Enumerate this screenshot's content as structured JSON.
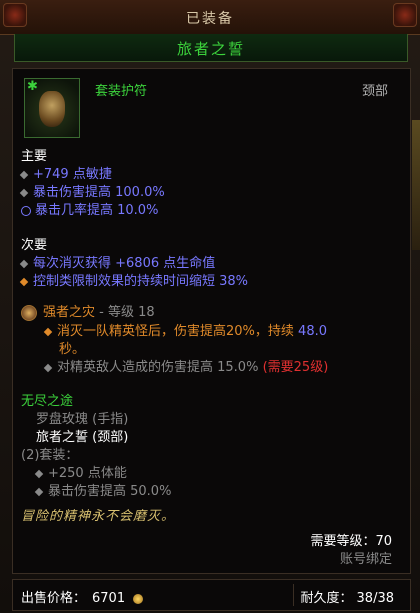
{
  "header": {
    "equipped_label": "已装备",
    "item_name": "旅者之誓"
  },
  "item": {
    "type": "套装护符",
    "slot": "颈部",
    "icon": "amulet-icon"
  },
  "primary": {
    "title": "主要",
    "stats": [
      "+749 点敏捷",
      "暴击伤害提高 100.0%",
      "暴击几率提高 10.0%"
    ]
  },
  "secondary": {
    "title": "次要",
    "stats": [
      "每次消灭获得 +6806 点生命值",
      "控制类限制效果的持续时间缩短 38%"
    ]
  },
  "legendary_gem": {
    "name": "强者之灾",
    "level": "- 等级 18",
    "effect_a": "消灭一队精英怪后，伤害提高20%，持续",
    "effect_a_value": "48.0",
    "effect_a_unit": "秒。",
    "effect_b": "对精英敌人造成的伤害提高 15.0%",
    "effect_b_req": "(需要25级)"
  },
  "set": {
    "name": "无尽之途",
    "items": [
      "罗盘玫瑰 (手指)",
      "旅者之誓 (颈部)"
    ],
    "bonus_title": "(2)套装：",
    "bonuses": [
      "+250 点体能",
      "暴击伤害提高 50.0%"
    ]
  },
  "flavor": "冒险的精神永不会磨灭。",
  "requirements": {
    "level_req": "需要等级：70",
    "bound": "账号绑定"
  },
  "footer": {
    "sell_label": "出售价格：",
    "sell_value": "6701",
    "durability_label": "耐久度：",
    "durability_value": "38/38"
  },
  "colors": {
    "set_green": "#3cd33c",
    "magic_blue": "#7878ff",
    "legendary_orange": "#e08a2a"
  }
}
